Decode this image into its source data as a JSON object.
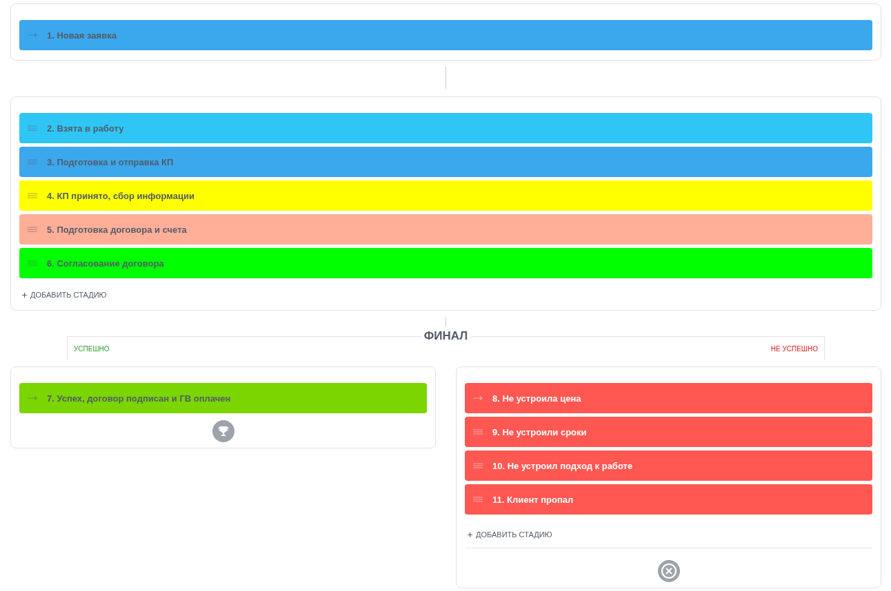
{
  "initial": {
    "stages": [
      {
        "kind": "fixed",
        "label": "1. Новая заявка",
        "color": "#3ba7ed"
      }
    ]
  },
  "process": {
    "stages": [
      {
        "kind": "draggable",
        "label": "2. Взята в работу",
        "color": "#2fc6f6"
      },
      {
        "kind": "draggable",
        "label": "3. Подготовка и отправка КП",
        "color": "#3ba7ed"
      },
      {
        "kind": "draggable",
        "label": "4. КП принято, сбор информации",
        "color": "#ffff00"
      },
      {
        "kind": "draggable",
        "label": "5. Подготовка договора и счета",
        "color": "#ffae98"
      },
      {
        "kind": "draggable",
        "label": "6. Согласование договора",
        "color": "#00ff00"
      }
    ],
    "add_label": "ДОБАВИТЬ СТАДИЮ"
  },
  "final": {
    "title": "ФИНАЛ",
    "success_label": "УСПЕШНО",
    "failure_label": "НЕ УСПЕШНО",
    "success": {
      "stages": [
        {
          "kind": "fixed",
          "label": "7. Успех, договор подписан и ГВ оплачен",
          "color": "#7bd500"
        }
      ]
    },
    "failure": {
      "stages": [
        {
          "kind": "fixed",
          "label": "8. Не устроила цена",
          "color": "#ff5752"
        },
        {
          "kind": "draggable",
          "label": "9. Не устроили сроки",
          "color": "#ff5752"
        },
        {
          "kind": "draggable",
          "label": "10. Не устроил подход к работе",
          "color": "#ff5752"
        },
        {
          "kind": "draggable",
          "label": "11. Клиент пропал",
          "color": "#ff5752"
        }
      ],
      "add_label": "ДОБАВИТЬ СТАДИЮ"
    }
  }
}
